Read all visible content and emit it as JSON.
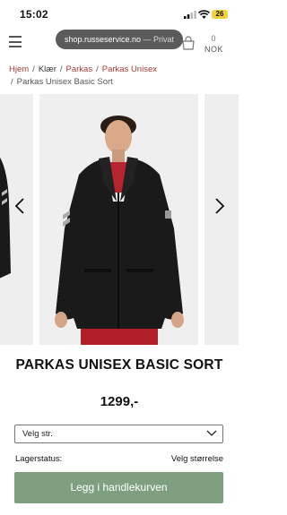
{
  "status_bar": {
    "time": "15:02",
    "battery": "26"
  },
  "header": {
    "url": "shop.russeservice.no",
    "url_separator": "—",
    "browsing_mode": "Privat",
    "cart_count": "0",
    "cart_currency": "NOK"
  },
  "breadcrumb": {
    "items": [
      "Hjem",
      "Klær",
      "Parkas",
      "Parkas Unisex"
    ],
    "current": "Parkas Unisex Basic Sort"
  },
  "product": {
    "title": "PARKAS UNISEX BASIC SORT",
    "price": "1299,-",
    "size_select": {
      "selected": "Velg str."
    },
    "stock_label": "Lagerstatus:",
    "stock_value": "Velg størrelse",
    "add_to_cart_label": "Legg i handlekurven"
  },
  "colors": {
    "accent_green": "#7ea080",
    "breadcrumb_link": "#a53b3b",
    "jacket": "#1a1a1a",
    "shirt_red": "#b7232f"
  },
  "icons": [
    "hamburger-menu-icon",
    "cart-icon",
    "chevron-left-icon",
    "chevron-right-icon",
    "chevron-down-icon"
  ]
}
